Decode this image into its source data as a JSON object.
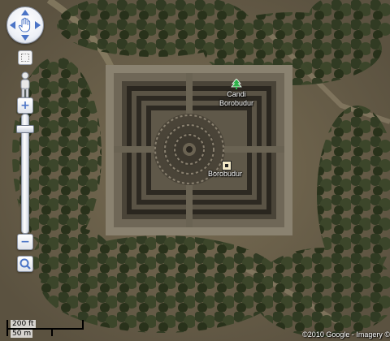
{
  "controls": {
    "pan_icon": "pan-hand-icon",
    "street_view_icon": "pegman-icon",
    "zoom_in_glyph": "+",
    "zoom_out_glyph": "−",
    "zoom_area_icon": "magnifier-icon",
    "minimap_icon": "overview-map-icon",
    "zoom_level_fraction": 0.9
  },
  "markers": {
    "candi": {
      "label_line1": "Candi",
      "label_line2": "Borobudur",
      "icon": "tree-icon",
      "color": "#2fb14a"
    },
    "center": {
      "label": "Borobudur",
      "icon": "location-square-icon"
    }
  },
  "scale": {
    "feet_label": "200 ft",
    "meters_label": "50 m"
  },
  "attribution": {
    "text": "©2010 Google - Imagery ©"
  },
  "colors": {
    "control_accent": "#4b74c6",
    "ground": "#6a6048",
    "vegetation": "#2f3a22"
  }
}
